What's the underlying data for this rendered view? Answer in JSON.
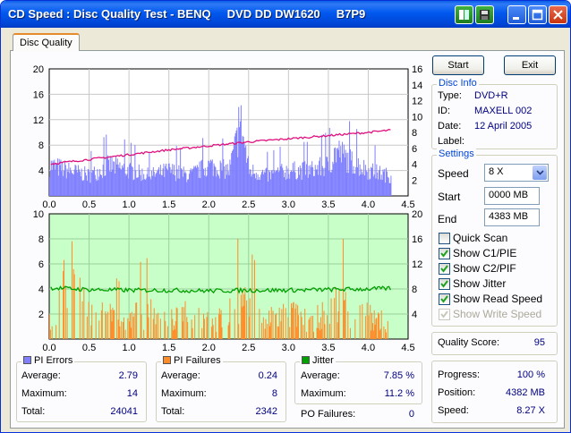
{
  "window": {
    "title": "CD Speed : Disc Quality Test - BENQ     DVD DD DW1620     B7P9"
  },
  "tabs": [
    {
      "label": "Disc Quality"
    }
  ],
  "buttons": {
    "start": "Start",
    "exit": "Exit"
  },
  "disc_info": {
    "title": "Disc Info",
    "type_label": "Type:",
    "type_value": "DVD+R",
    "id_label": "ID:",
    "id_value": "MAXELL 002",
    "date_label": "Date:",
    "date_value": "12 April 2005",
    "label_label": "Label:",
    "label_value": ""
  },
  "settings": {
    "title": "Settings",
    "speed_label": "Speed",
    "speed_value": "8 X",
    "start_label": "Start",
    "start_value": "0000 MB",
    "end_label": "End",
    "end_value": "4383 MB",
    "checkboxes": [
      {
        "label": "Quick Scan",
        "checked": false,
        "disabled": false
      },
      {
        "label": "Show C1/PIE",
        "checked": true,
        "disabled": false
      },
      {
        "label": "Show C2/PIF",
        "checked": true,
        "disabled": false
      },
      {
        "label": "Show Jitter",
        "checked": true,
        "disabled": false
      },
      {
        "label": "Show Read Speed",
        "checked": true,
        "disabled": false
      },
      {
        "label": "Show Write Speed",
        "checked": true,
        "disabled": true
      }
    ]
  },
  "quality": {
    "label": "Quality Score:",
    "value": "95"
  },
  "progress": {
    "progress_label": "Progress:",
    "progress_value": "100 %",
    "position_label": "Position:",
    "position_value": "4382 MB",
    "speed_label": "Speed:",
    "speed_value": "8.27 X"
  },
  "stats": {
    "pi_errors": {
      "title": "PI Errors",
      "average_label": "Average:",
      "average": "2.79",
      "maximum_label": "Maximum:",
      "maximum": "14",
      "total_label": "Total:",
      "total": "24041"
    },
    "pi_failures": {
      "title": "PI Failures",
      "average_label": "Average:",
      "average": "0.24",
      "maximum_label": "Maximum:",
      "maximum": "8",
      "total_label": "Total:",
      "total": "2342"
    },
    "jitter": {
      "title": "Jitter",
      "average_label": "Average:",
      "average": "7.85 %",
      "maximum_label": "Maximum:",
      "maximum": "11.2 %"
    },
    "po_failures": {
      "label": "PO Failures:",
      "value": "0"
    }
  },
  "colors": {
    "pi_errors": "#8080ff",
    "pi_failures": "#ff8c28",
    "jitter": "#00a000",
    "read_speed": "#e0107f",
    "lower_bg": "#c8ffc8",
    "upper_bg": "#ffffff"
  },
  "chart_data": [
    {
      "type": "bar",
      "name": "PI Errors / Read Speed",
      "x_ticks": [
        "0.0",
        "0.5",
        "1.0",
        "1.5",
        "2.0",
        "2.5",
        "3.0",
        "3.5",
        "4.0",
        "4.5"
      ],
      "y_left_ticks": [
        "4",
        "8",
        "12",
        "16",
        "20"
      ],
      "y_right_ticks": [
        "2",
        "4",
        "6",
        "8",
        "10",
        "12",
        "14",
        "16"
      ],
      "xlim": [
        0,
        4.5
      ],
      "ylim_left": [
        0,
        20
      ],
      "ylim_right": [
        0,
        16
      ],
      "series": [
        {
          "name": "PI Errors",
          "x": [
            0.0,
            0.25,
            0.5,
            0.75,
            1.0,
            1.25,
            1.5,
            1.75,
            2.0,
            2.25,
            2.4,
            2.5,
            2.75,
            3.0,
            3.25,
            3.5,
            3.6,
            3.75,
            4.0,
            4.25
          ],
          "values": [
            6,
            5,
            4,
            6,
            5,
            4,
            5,
            4,
            6,
            5,
            14,
            5,
            4,
            5,
            5,
            6,
            9,
            7,
            5,
            4
          ]
        },
        {
          "name": "Read Speed",
          "x": [
            0.0,
            0.5,
            1.0,
            1.5,
            2.0,
            2.5,
            3.0,
            3.5,
            4.0,
            4.3
          ],
          "values": [
            4.0,
            4.6,
            5.2,
            5.8,
            6.3,
            6.8,
            7.2,
            7.6,
            8.0,
            8.3
          ]
        }
      ]
    },
    {
      "type": "bar",
      "name": "PI Failures / Jitter",
      "x_ticks": [
        "0.0",
        "0.5",
        "1.0",
        "1.5",
        "2.0",
        "2.5",
        "3.0",
        "3.5",
        "4.0",
        "4.5"
      ],
      "y_left_ticks": [
        "2",
        "4",
        "6",
        "8",
        "10"
      ],
      "y_right_ticks": [
        "4",
        "8",
        "12",
        "16",
        "20"
      ],
      "xlim": [
        0,
        4.5
      ],
      "ylim_left": [
        0,
        10
      ],
      "ylim_right": [
        0,
        20
      ],
      "series": [
        {
          "name": "PI Failures",
          "x": [
            0.0,
            0.3,
            0.6,
            0.9,
            1.2,
            1.5,
            1.8,
            2.1,
            2.4,
            2.7,
            3.0,
            3.3,
            3.6,
            3.9,
            4.2
          ],
          "values": [
            2,
            8,
            3,
            2,
            3,
            2,
            3,
            2,
            4,
            2,
            3,
            2,
            4,
            3,
            2
          ]
        },
        {
          "name": "Jitter",
          "x": [
            0.0,
            0.5,
            1.0,
            1.5,
            2.0,
            2.5,
            3.0,
            3.5,
            4.0,
            4.3
          ],
          "values": [
            8.2,
            7.9,
            7.8,
            7.8,
            7.7,
            7.8,
            7.8,
            7.9,
            8.0,
            8.1
          ]
        }
      ]
    }
  ]
}
